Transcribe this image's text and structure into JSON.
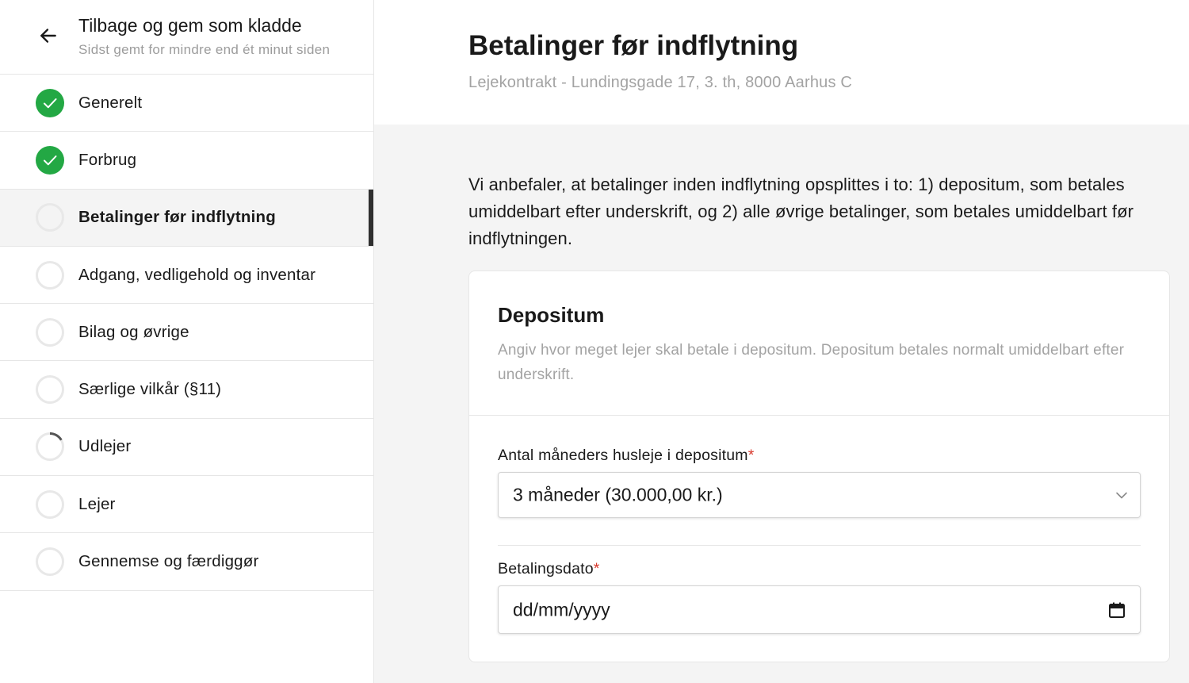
{
  "sidebar": {
    "header": {
      "title": "Tilbage og gem som kladde",
      "subtitle": "Sidst gemt for mindre end ét minut siden"
    },
    "items": [
      {
        "label": "Generelt",
        "status": "complete"
      },
      {
        "label": "Forbrug",
        "status": "complete"
      },
      {
        "label": "Betalinger før indflytning",
        "status": "active"
      },
      {
        "label": "Adgang, vedligehold og inventar",
        "status": "empty"
      },
      {
        "label": "Bilag og øvrige",
        "status": "empty"
      },
      {
        "label": "Særlige vilkår (§11)",
        "status": "empty"
      },
      {
        "label": "Udlejer",
        "status": "partial"
      },
      {
        "label": "Lejer",
        "status": "empty"
      },
      {
        "label": "Gennemse og færdiggør",
        "status": "empty"
      }
    ]
  },
  "main": {
    "title": "Betalinger før indflytning",
    "subtitle": "Lejekontrakt - Lundingsgade 17, 3. th, 8000 Aarhus C",
    "intro": "Vi anbefaler, at betalinger inden indflytning opsplittes i to: 1) depositum, som betales umiddelbart efter underskrift, og 2) alle øvrige betalinger, som betales umiddelbart før indflytningen.",
    "card": {
      "title": "Depositum",
      "description": "Angiv hvor meget lejer skal betale i depositum. Depositum betales normalt umiddelbart efter underskrift.",
      "months_label": "Antal måneders husleje i depositum",
      "months_value": "3 måneder (30.000,00 kr.)",
      "date_label": "Betalingsdato",
      "date_placeholder": "dd/mm/yyyy",
      "required_marker": "*"
    }
  },
  "colors": {
    "complete": "#23a844",
    "active_bar": "#2f2f2f",
    "required": "#d83a2e",
    "muted_text": "#a3a3a3"
  }
}
